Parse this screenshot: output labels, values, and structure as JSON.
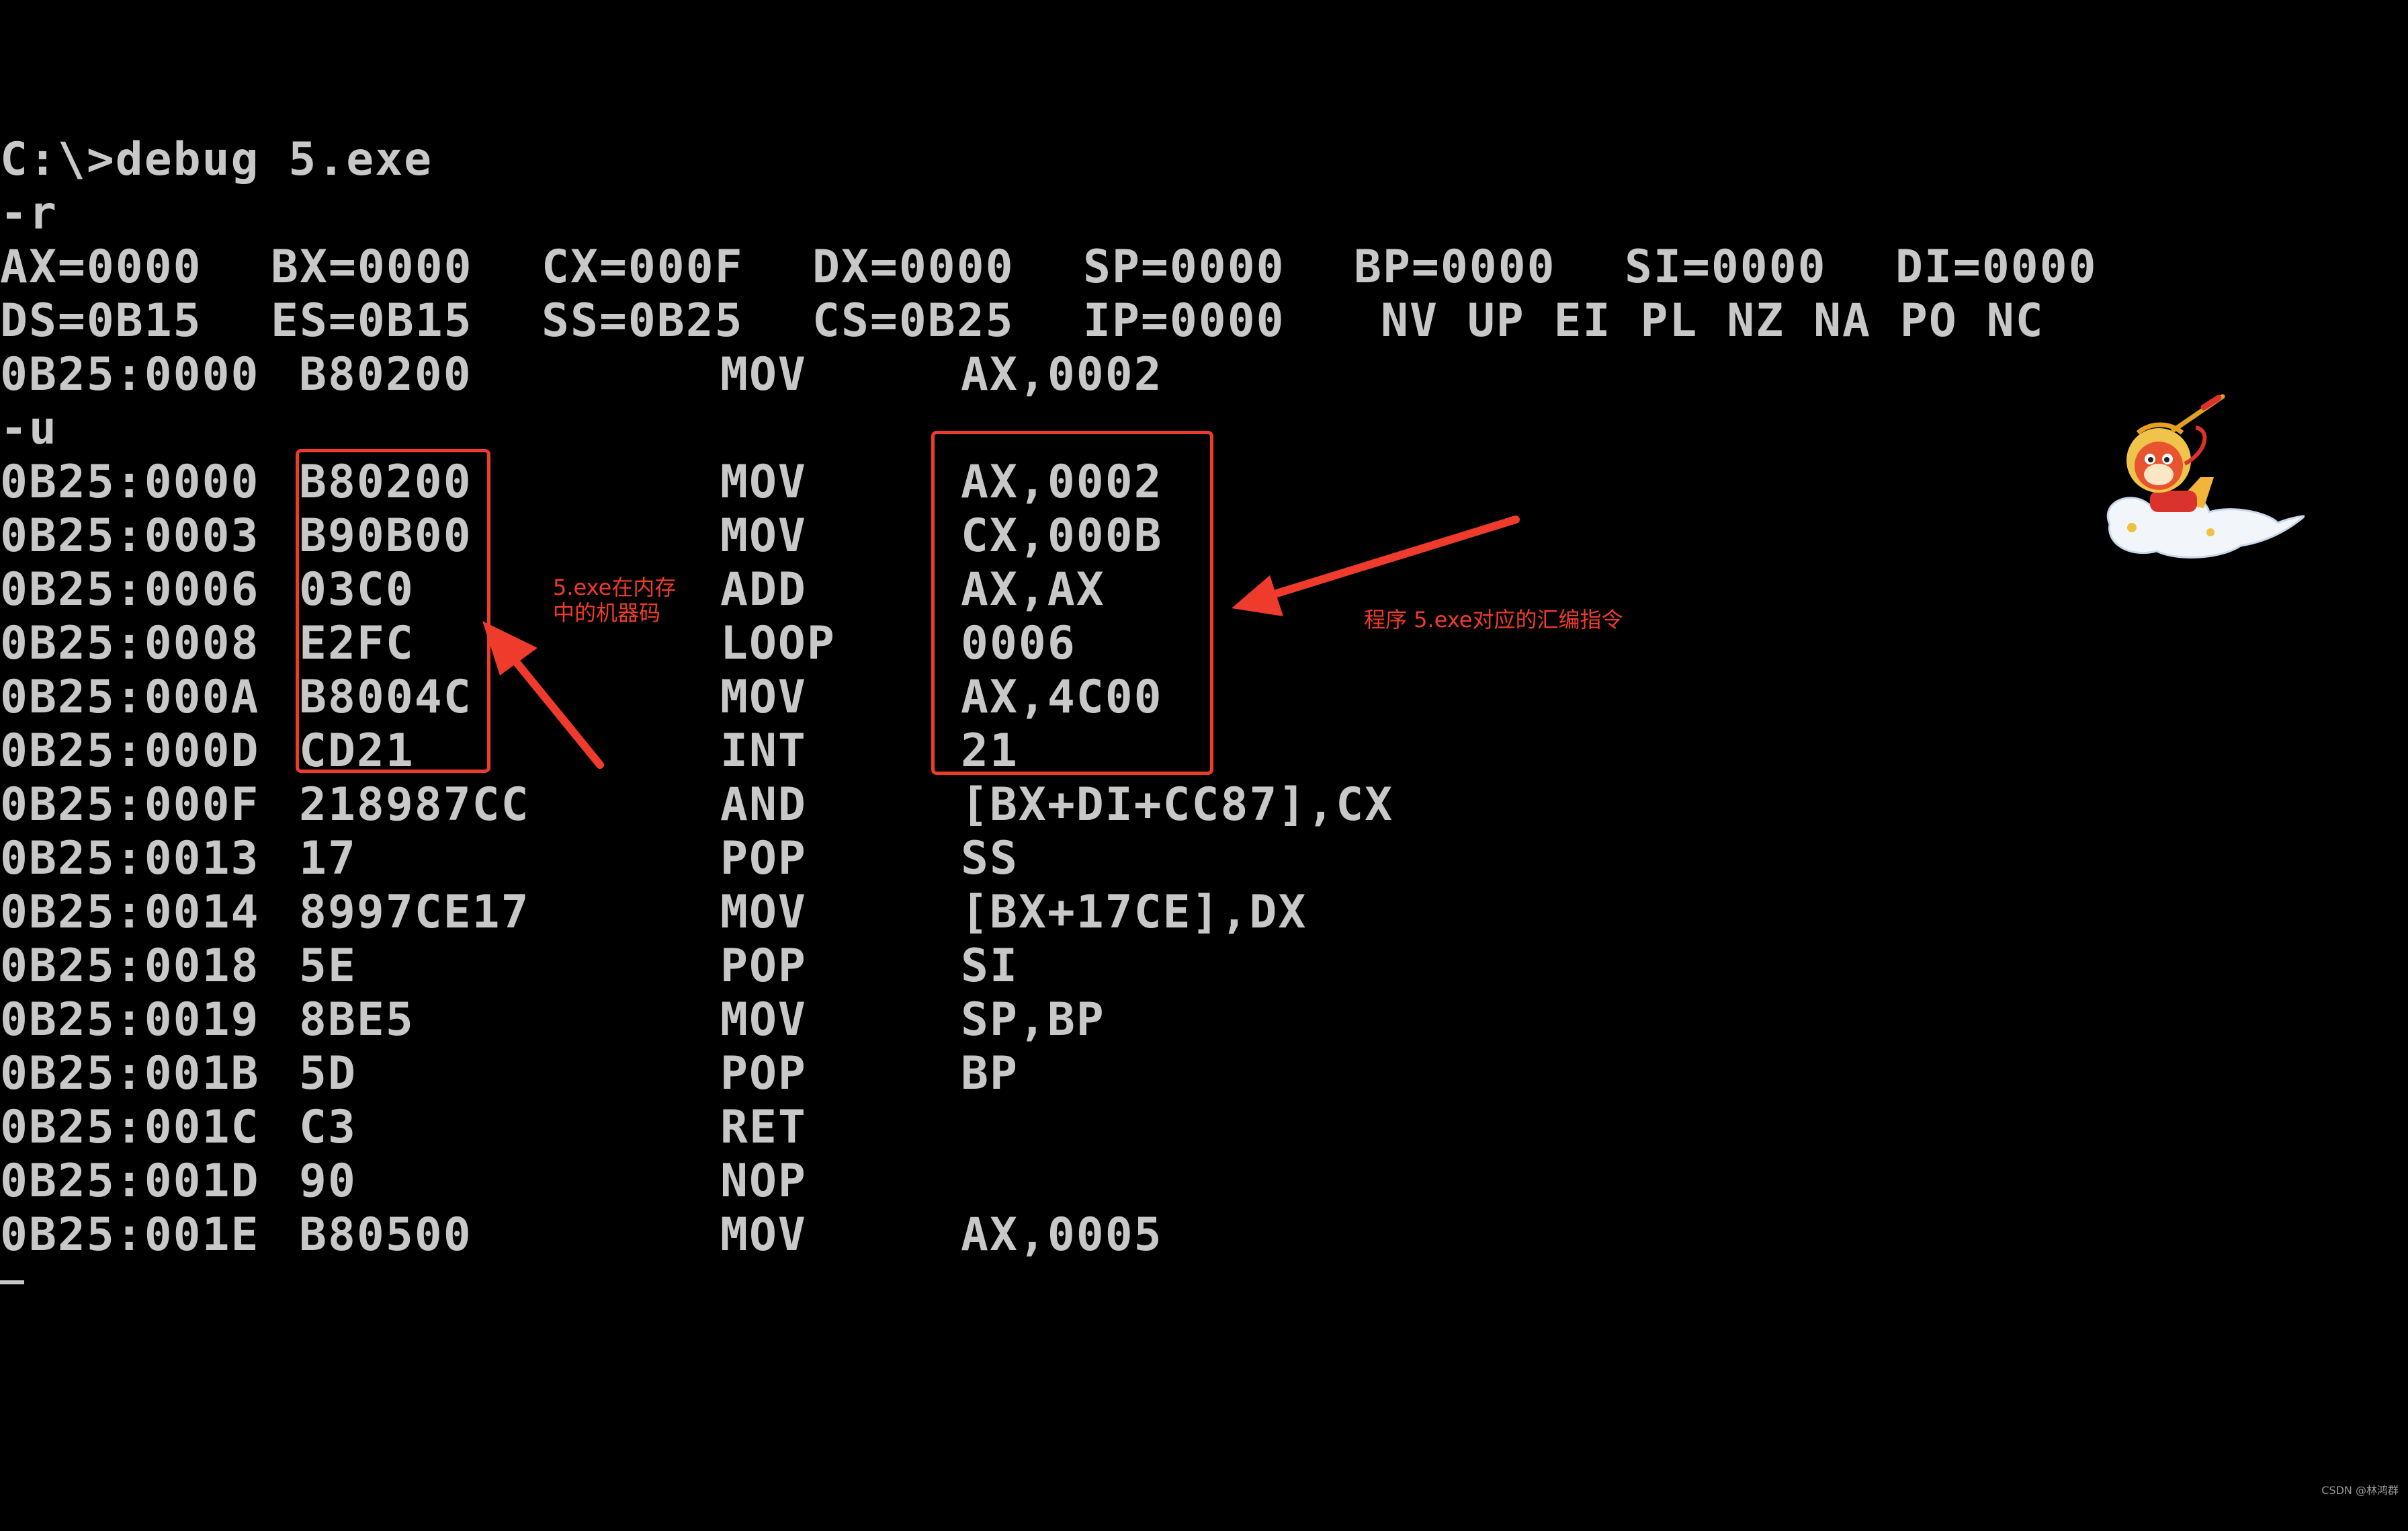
{
  "terminal": {
    "command_line": "C:\\>debug 5.exe",
    "r_command": "-r",
    "registers_row1": [
      "AX=0000",
      "BX=0000",
      "CX=000F",
      "DX=0000",
      "SP=0000",
      "BP=0000",
      "SI=0000",
      "DI=0000"
    ],
    "registers_row2": [
      "DS=0B15",
      "ES=0B15",
      "SS=0B25",
      "CS=0B25",
      "IP=0000"
    ],
    "flags": "NV UP EI PL NZ NA PO NC",
    "current_instruction": {
      "addr": "0B25:0000",
      "code": "B80200",
      "mnem": "MOV",
      "oper": "AX,0002"
    },
    "u_command": "-u",
    "disassembly": [
      {
        "addr": "0B25:0000",
        "code": "B80200",
        "mnem": "MOV",
        "oper": "AX,0002"
      },
      {
        "addr": "0B25:0003",
        "code": "B90B00",
        "mnem": "MOV",
        "oper": "CX,000B"
      },
      {
        "addr": "0B25:0006",
        "code": "03C0",
        "mnem": "ADD",
        "oper": "AX,AX"
      },
      {
        "addr": "0B25:0008",
        "code": "E2FC",
        "mnem": "LOOP",
        "oper": "0006"
      },
      {
        "addr": "0B25:000A",
        "code": "B8004C",
        "mnem": "MOV",
        "oper": "AX,4C00"
      },
      {
        "addr": "0B25:000D",
        "code": "CD21",
        "mnem": "INT",
        "oper": "21"
      },
      {
        "addr": "0B25:000F",
        "code": "218987CC",
        "mnem": "AND",
        "oper": "[BX+DI+CC87],CX"
      },
      {
        "addr": "0B25:0013",
        "code": "17",
        "mnem": "POP",
        "oper": "SS"
      },
      {
        "addr": "0B25:0014",
        "code": "8997CE17",
        "mnem": "MOV",
        "oper": "[BX+17CE],DX"
      },
      {
        "addr": "0B25:0018",
        "code": "5E",
        "mnem": "POP",
        "oper": "SI"
      },
      {
        "addr": "0B25:0019",
        "code": "8BE5",
        "mnem": "MOV",
        "oper": "SP,BP"
      },
      {
        "addr": "0B25:001B",
        "code": "5D",
        "mnem": "POP",
        "oper": "BP"
      },
      {
        "addr": "0B25:001C",
        "code": "C3",
        "mnem": "RET",
        "oper": ""
      },
      {
        "addr": "0B25:001D",
        "code": "90",
        "mnem": "NOP",
        "oper": ""
      },
      {
        "addr": "0B25:001E",
        "code": "B80500",
        "mnem": "MOV",
        "oper": "AX,0005"
      }
    ]
  },
  "annotations": {
    "machine_code_note": "5.exe在内存\n中的机器码",
    "assembly_note": "程序 5.exe对应的汇编指令",
    "color": "#ee3b2b"
  },
  "watermark": "CSDN @林鸿群"
}
